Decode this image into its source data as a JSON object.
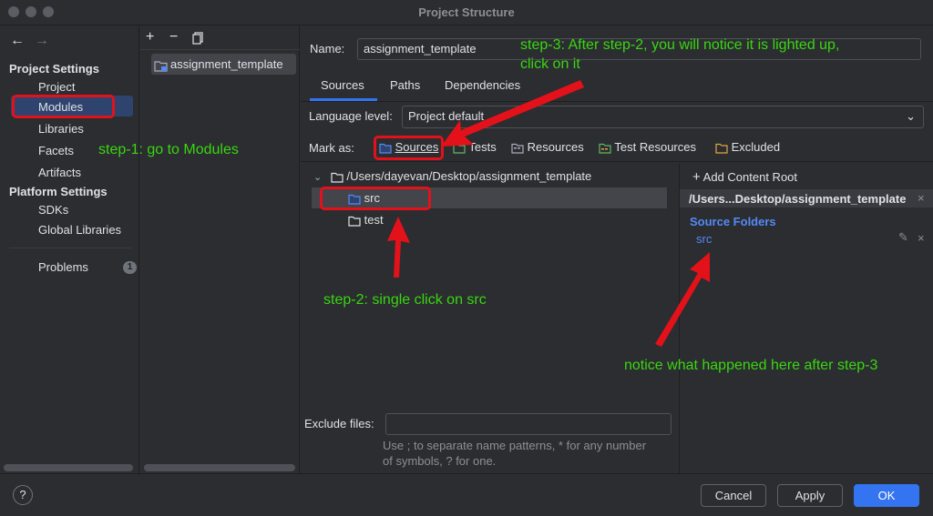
{
  "window": {
    "title": "Project Structure"
  },
  "nav": {
    "back_icon": "arrow-left-icon",
    "forward_icon": "arrow-right-icon",
    "project_settings_header": "Project Settings",
    "project_settings": [
      "Project",
      "Modules",
      "Libraries",
      "Facets",
      "Artifacts"
    ],
    "platform_settings_header": "Platform Settings",
    "platform_settings": [
      "SDKs",
      "Global Libraries"
    ],
    "problems_label": "Problems",
    "problems_count": "1",
    "selected": "Modules"
  },
  "modules": {
    "toolbar": {
      "add_icon": "plus-icon",
      "remove_icon": "minus-icon",
      "copy_icon": "copy-icon"
    },
    "items": [
      "assignment_template"
    ]
  },
  "editor": {
    "name_label": "Name:",
    "name_value": "assignment_template",
    "tabs": [
      "Sources",
      "Paths",
      "Dependencies"
    ],
    "active_tab": "Sources",
    "language_level_label": "Language level:",
    "language_level_value": "Project default",
    "mark_as_label": "Mark as:",
    "mark_as": [
      "Sources",
      "Tests",
      "Resources",
      "Test Resources",
      "Excluded"
    ],
    "tree_root": "/Users/dayevan/Desktop/assignment_template",
    "tree_children": [
      "src",
      "test"
    ],
    "exclude_label": "Exclude files:",
    "exclude_value": "",
    "exclude_hint_1": "Use ; to separate name patterns, * for any number",
    "exclude_hint_2": "of symbols, ? for one."
  },
  "content_root": {
    "add_label": "Add Content Root",
    "root_path": "/Users...Desktop/assignment_template",
    "source_folders_header": "Source Folders",
    "source_folders": [
      "src"
    ]
  },
  "buttons": {
    "help": "?",
    "cancel": "Cancel",
    "apply": "Apply",
    "ok": "OK"
  },
  "annotations": {
    "step1": "step-1: go to Modules",
    "step2": "step-2: single click on src",
    "step3_line1": "step-3: After step-2, you will notice it is lighted up,",
    "step3_line2": "click on it",
    "notice": "notice what happened here after step-3"
  },
  "colors": {
    "annotation_text": "#39d611",
    "annotation_red": "#e3111a",
    "accent": "#3574f0",
    "source_folder_blue": "#548af7"
  }
}
